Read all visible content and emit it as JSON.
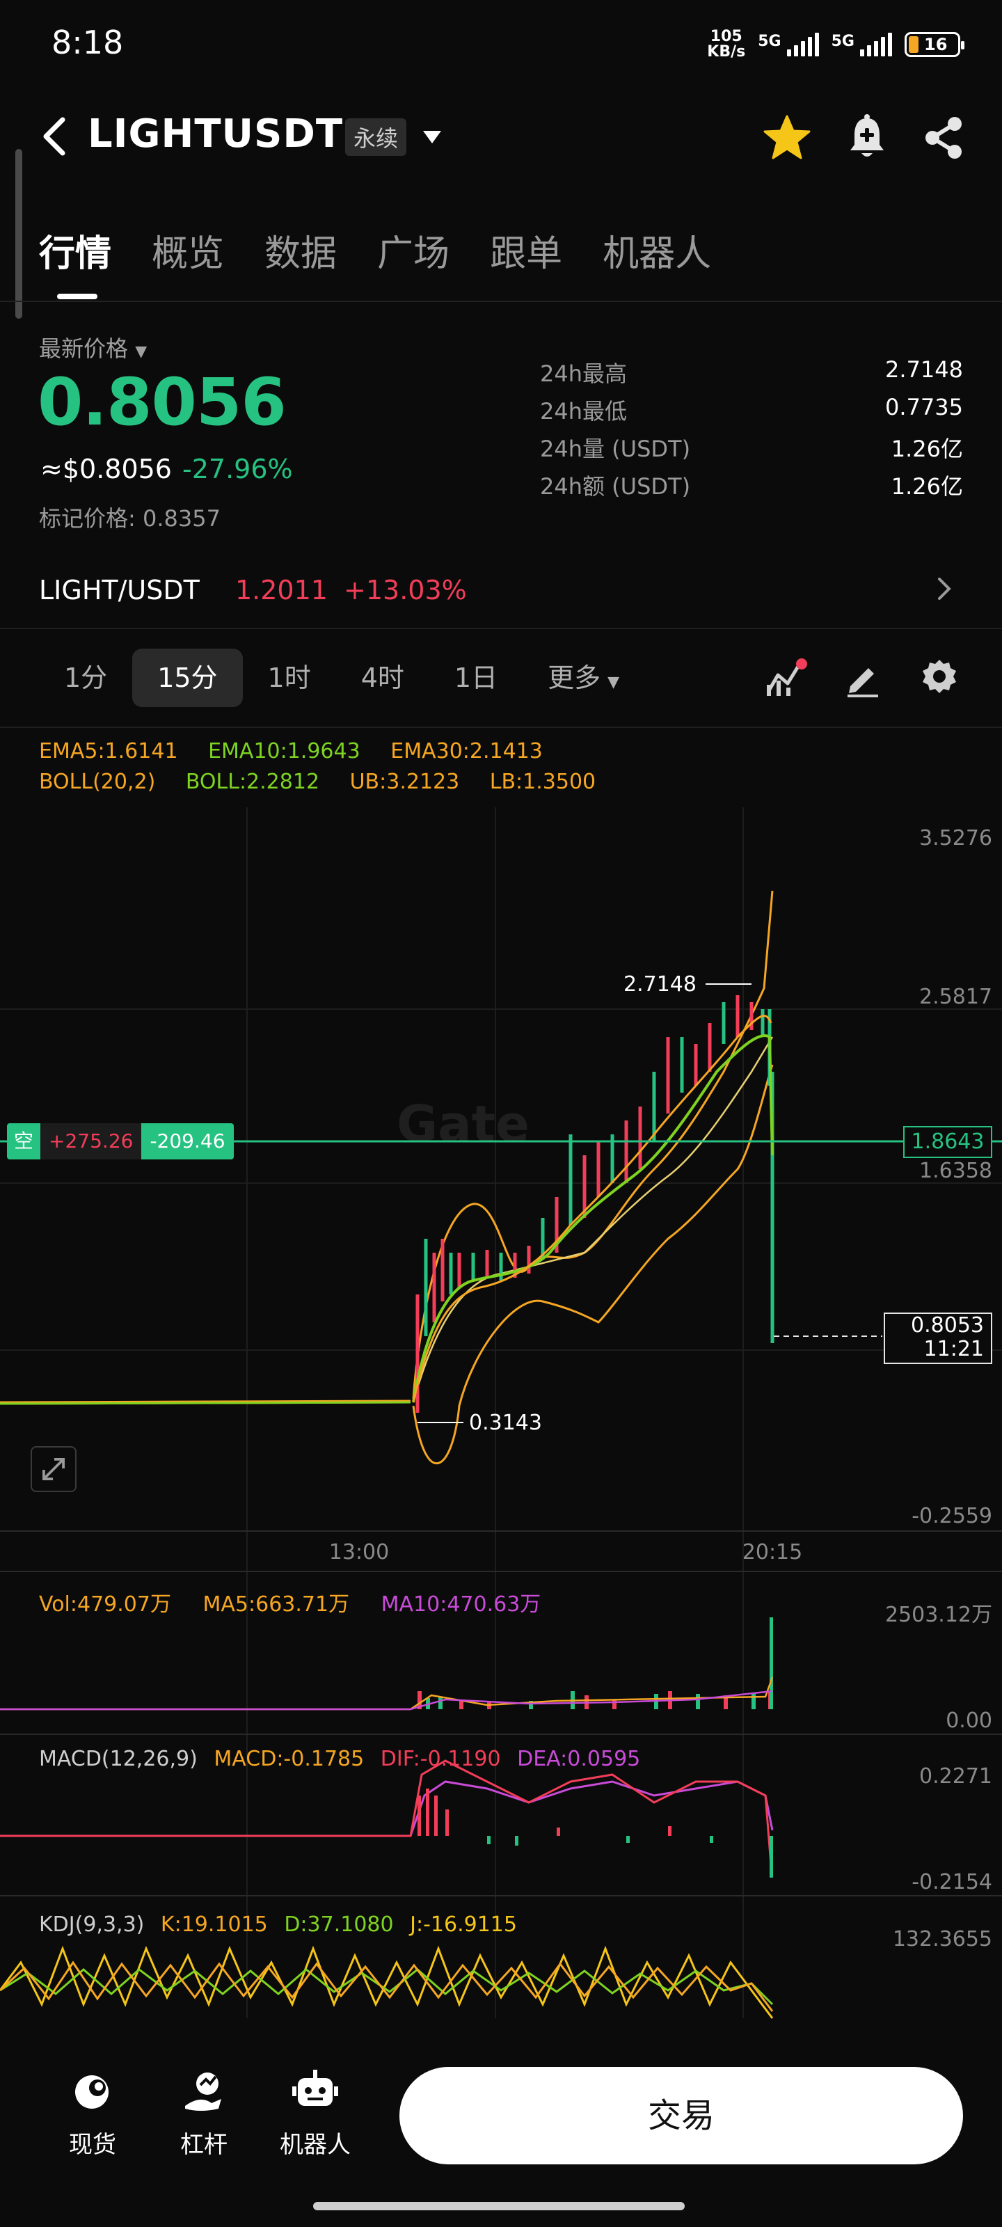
{
  "status_bar": {
    "time": "8:18",
    "net_speed_value": "105",
    "net_speed_unit": "KB/s",
    "signal_1": "5G",
    "signal_2": "5G",
    "battery": "16"
  },
  "header": {
    "pair": "LIGHTUSDT",
    "badge": "永续",
    "icons": [
      "back-icon",
      "dropdown-caret-icon",
      "star-icon",
      "bell-icon",
      "share-icon"
    ],
    "star_color": "#f5c518"
  },
  "tabs": [
    {
      "label": "行情",
      "active": true
    },
    {
      "label": "概览",
      "active": false
    },
    {
      "label": "数据",
      "active": false
    },
    {
      "label": "广场",
      "active": false
    },
    {
      "label": "跟单",
      "active": false
    },
    {
      "label": "机器人",
      "active": false
    }
  ],
  "price": {
    "label": "最新价格",
    "last": "0.8056",
    "usd": "≈$0.8056",
    "change": "-27.96%",
    "mark": "标记价格: 0.8357"
  },
  "stats": [
    {
      "label": "24h最高",
      "value": "2.7148"
    },
    {
      "label": "24h最低",
      "value": "0.7735"
    },
    {
      "label": "24h量 (USDT)",
      "value": "1.26亿"
    },
    {
      "label": "24h额 (USDT)",
      "value": "1.26亿"
    }
  ],
  "index": {
    "pair": "LIGHT/USDT",
    "price": "1.2011",
    "change": "+13.03%"
  },
  "intervals": {
    "items": [
      "1分",
      "15分",
      "1时",
      "4时",
      "1日"
    ],
    "active": "15分",
    "more": "更多"
  },
  "main_legend": {
    "ema5": "EMA5:1.6141",
    "ema10": "EMA10:1.9643",
    "ema30": "EMA30:2.1413",
    "boll": "BOLL(20,2)",
    "boll_mid": "BOLL:2.2812",
    "ub": "UB:3.2123",
    "lb": "LB:1.3500"
  },
  "main_axis": {
    "y_labels": [
      "3.5276",
      "2.5817",
      "1.6358",
      "-0.2559"
    ],
    "x_labels": [
      "13:00",
      "20:15"
    ],
    "high_marker": "2.7148",
    "low_marker": "0.3143"
  },
  "position": {
    "side": "空",
    "pnl": "+275.26",
    "qty": "-209.46",
    "entry": "1.8643"
  },
  "current_price_tag": {
    "price": "0.8053",
    "countdown": "11:21"
  },
  "volume": {
    "vol": "Vol:479.07万",
    "ma5": "MA5:663.71万",
    "ma10": "MA10:470.63万",
    "y_top": "2503.12万",
    "y_bottom": "0.00"
  },
  "macd": {
    "params": "MACD(12,26,9)",
    "macd": "MACD:-0.1785",
    "dif": "DIF:-0.1190",
    "dea": "DEA:0.0595",
    "y_top": "0.2271",
    "y_bottom": "-0.2154"
  },
  "kdj": {
    "params": "KDJ(9,3,3)",
    "k": "K:19.1015",
    "d": "D:37.1080",
    "j": "J:-16.9115",
    "y_top": "132.3655"
  },
  "bottom_nav": {
    "items": [
      {
        "label": "现货",
        "icon": "spot-icon"
      },
      {
        "label": "杠杆",
        "icon": "margin-icon"
      },
      {
        "label": "机器人",
        "icon": "robot-icon"
      }
    ],
    "trade": "交易"
  },
  "colors": {
    "up": "#26c281",
    "down": "#f23e58",
    "ema5": "#f5a623",
    "ema10": "#7ed321",
    "ema30": "#f5a623",
    "boll": "#f5a623",
    "macd_dea": "#c94bd8"
  },
  "watermark": "Gate"
}
